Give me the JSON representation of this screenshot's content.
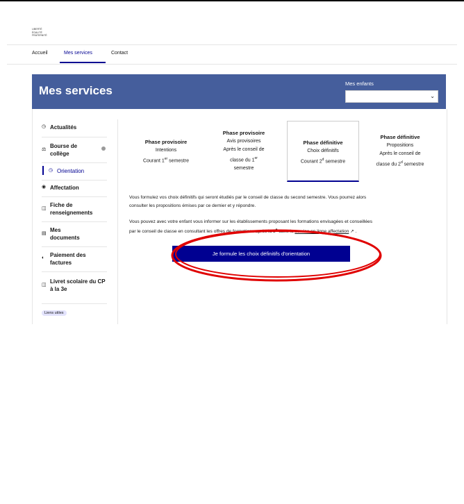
{
  "logo": {
    "lines": [
      "LIBERTÉ",
      "ÉGALITÉ",
      "FRATERNITÉ"
    ]
  },
  "nav": {
    "items": [
      "Accueil",
      "Mes services",
      "Contact"
    ]
  },
  "header": {
    "title": "Mes services",
    "children_label": "Mes enfants",
    "children_value": ""
  },
  "sidebar": {
    "items": [
      {
        "label": "Actualités",
        "icon": "clock-icon"
      },
      {
        "label": "Bourse de collège",
        "icon": "bank-icon"
      },
      {
        "label": "Orientation",
        "icon": "compass-icon"
      },
      {
        "label": "Affectation",
        "icon": "target-icon"
      },
      {
        "label": "Fiche de renseignements",
        "icon": "file-icon"
      },
      {
        "label": "Mes documents",
        "icon": "documents-icon"
      },
      {
        "label": "Paiement des factures",
        "icon": "payment-icon"
      },
      {
        "label": "Livret scolaire du CP à la 3e",
        "icon": "book-icon"
      }
    ],
    "useful_links": "Liens utiles"
  },
  "phases": [
    {
      "title": "Phase provisoire",
      "line1": "Intentions",
      "line2": "Courant 1",
      "sup": "er",
      "line2b": " semestre"
    },
    {
      "title": "Phase provisoire",
      "line1": "Avis provisoires",
      "line2": "Après le conseil de",
      "line3": "classe du 1",
      "sup": "er",
      "line4": "semestre"
    },
    {
      "title": "Phase définitive",
      "line1": "Choix définitifs",
      "line2": "Courant 2",
      "sup": "d",
      "line2b": " semestre"
    },
    {
      "title": "Phase définitive",
      "line1": "Propositions",
      "line2": "Après le conseil de",
      "line3": "classe du 2",
      "sup": "d",
      "line3b": " semestre"
    }
  ],
  "paragraph1": {
    "line1": "Vous formulez vos choix définitifs qui seront étudiés par le conseil de classe du second semestre. Vous pourrez alors",
    "line2": "consulter les propositions émises par ce dernier et y répondre."
  },
  "paragraph2": {
    "line1": "Vous pouvez avec votre enfant vous informer sur les établissements proposant les formations envisagées et conseillées",
    "line2_pre": "par le conseil de classe en consultant les offres de formations après la 3",
    "line2_sup": "e",
    "line2_mid": " dans le ",
    "link": "service en ligne affectation",
    "line2_end": " ."
  },
  "cta": {
    "label": "Je formule les choix définitifs d'orientation"
  },
  "colors": {
    "header_bg": "#455e9c",
    "accent": "#000091",
    "annotation": "#e00000"
  }
}
